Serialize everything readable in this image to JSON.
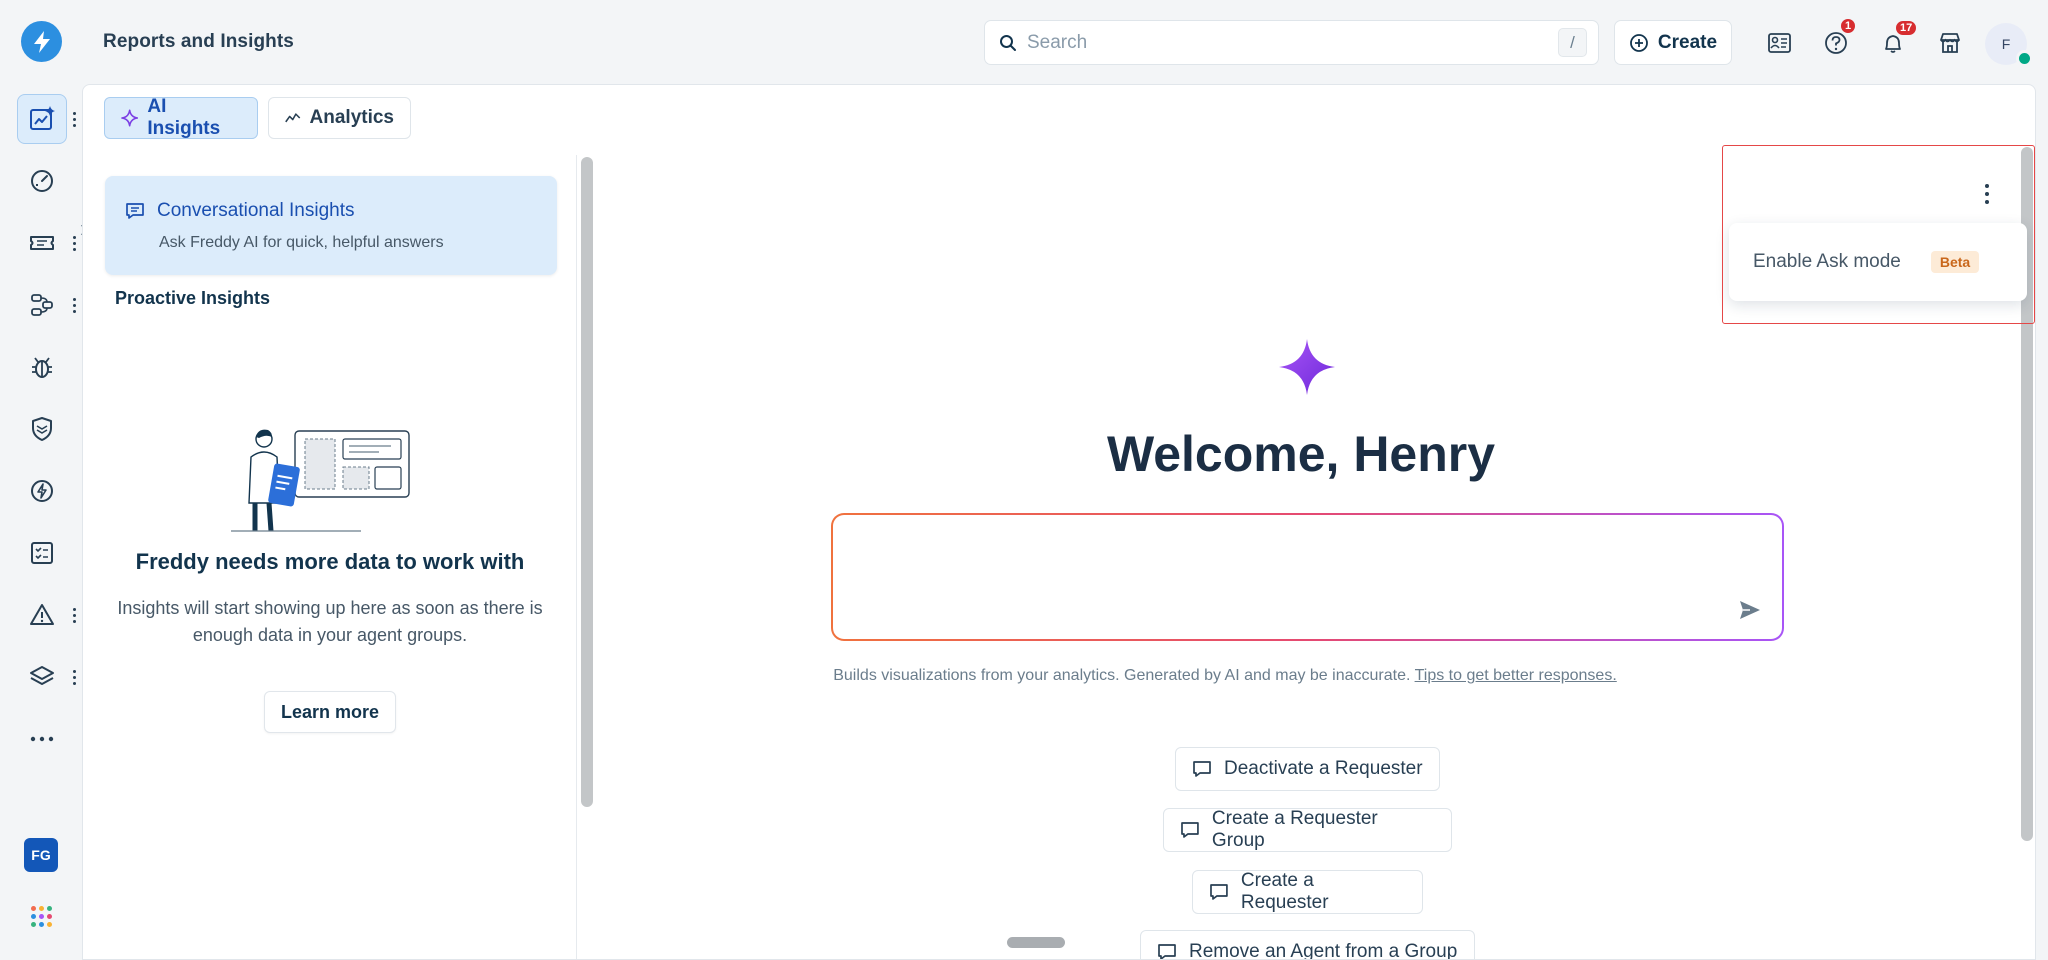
{
  "app": {
    "title": "Reports and Insights"
  },
  "search": {
    "placeholder": "Search",
    "shortcut": "/"
  },
  "header": {
    "create_label": "Create",
    "help_badge": "1",
    "notifications_badge": "17",
    "avatar_initial": "F"
  },
  "sidebar": {
    "items": [
      {
        "name": "ai-insights",
        "icon": "chart-sparkle-icon",
        "active": true
      },
      {
        "name": "dashboard",
        "icon": "speedometer-icon"
      },
      {
        "name": "tickets",
        "icon": "ticket-icon"
      },
      {
        "name": "workflows",
        "icon": "flow-icon"
      },
      {
        "name": "problems",
        "icon": "bug-icon"
      },
      {
        "name": "changes",
        "icon": "shield-icon"
      },
      {
        "name": "releases",
        "icon": "bolt-circle-icon"
      },
      {
        "name": "tasks",
        "icon": "checklist-icon"
      },
      {
        "name": "alerts",
        "icon": "alert-triangle-icon"
      },
      {
        "name": "assets",
        "icon": "layers-icon"
      },
      {
        "name": "more",
        "icon": "more-icon"
      }
    ],
    "workspace_badge": "FG"
  },
  "tabs": {
    "ai_insights": "AI Insights",
    "analytics": "Analytics"
  },
  "left_panel": {
    "conversational": {
      "title": "Conversational Insights",
      "subtitle": "Ask Freddy AI for quick, helpful answers"
    },
    "proactive_title": "Proactive Insights",
    "empty_heading": "Freddy needs more data to work with",
    "empty_text": "Insights will start showing up here as soon as there is enough data in your agent groups.",
    "learn_more": "Learn more"
  },
  "chat": {
    "welcome": "Welcome, Henry",
    "input_placeholder": "",
    "disclaimer": "Builds visualizations from your analytics. Generated by AI and may be inaccurate.",
    "tips_link": "Tips to get better responses.",
    "suggestions": [
      "Deactivate a Requester",
      "Create a Requester Group",
      "Create a Requester",
      "Remove an Agent from a Group"
    ]
  },
  "menu": {
    "enable_ask_mode": "Enable Ask mode",
    "beta": "Beta"
  },
  "colors": {
    "brand": "#2c8fe0",
    "active_tab_bg": "#dcecfb",
    "badge_red": "#d72d30",
    "sparkle_purple": "#7b3fe4",
    "online_green": "#00a886"
  }
}
